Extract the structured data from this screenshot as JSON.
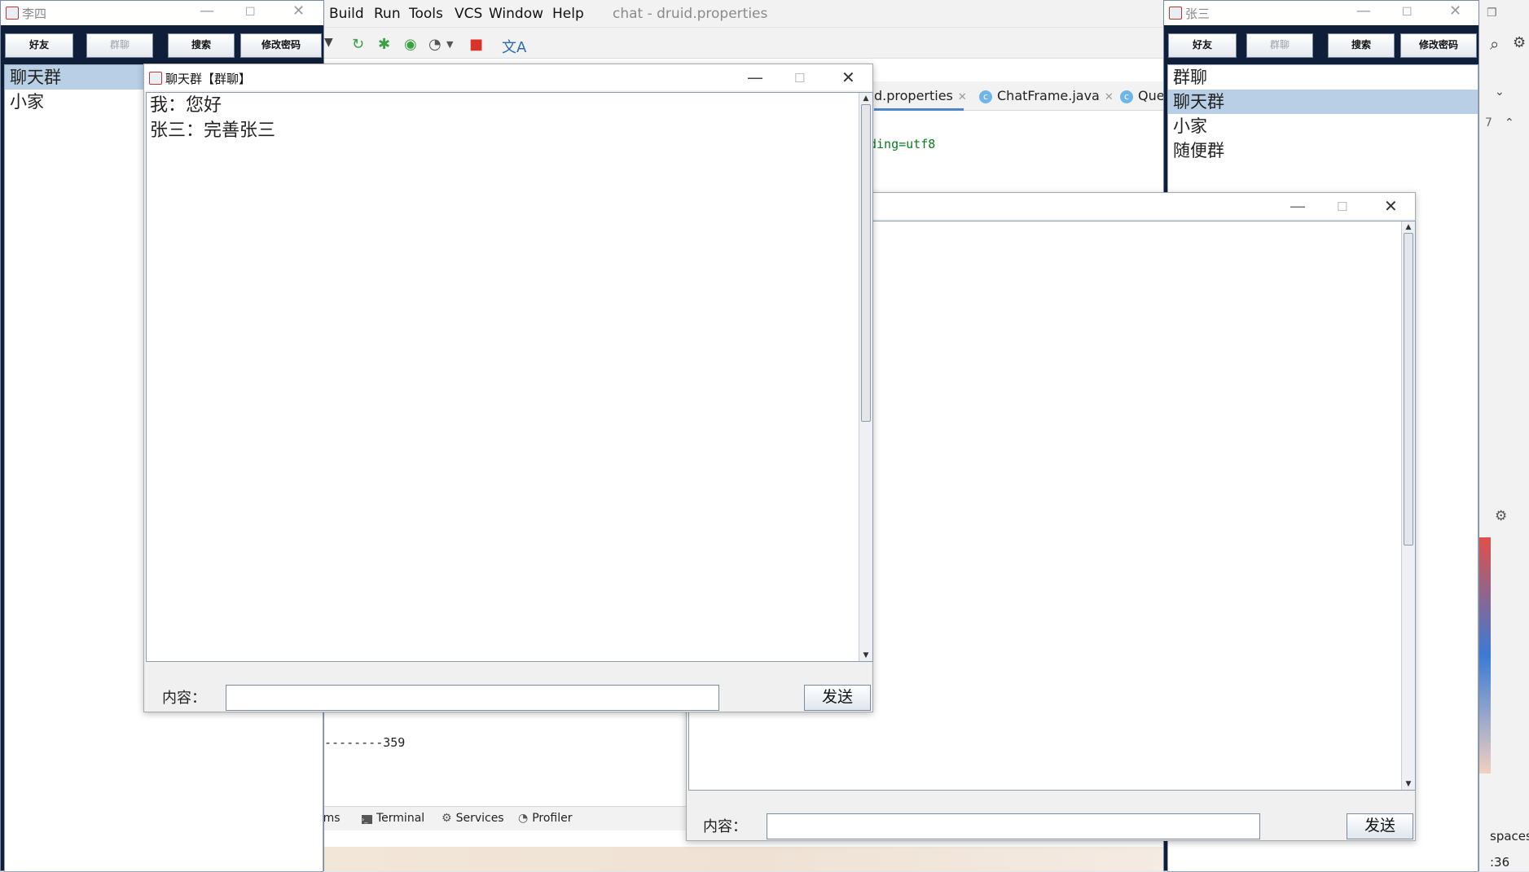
{
  "ide": {
    "menu": [
      "Build",
      "Run",
      "Tools",
      "VCS",
      "Window",
      "Help"
    ],
    "title": "chat - druid.properties",
    "tabs": [
      {
        "label": "d.properties",
        "closable": true
      },
      {
        "label": "ChatFrame.java",
        "closable": true
      },
      {
        "label": "Que",
        "closable": false
      }
    ],
    "code_line": "ding=utf8",
    "console_line": "--------359",
    "bottom_tools": [
      "ems",
      "Terminal",
      "Services",
      "Profiler"
    ],
    "right_fragments": {
      "line_no": "7",
      "spaces": "spaces",
      "time": ":36"
    }
  },
  "client_lisi": {
    "title": "李四",
    "buttons": [
      "好友",
      "群聊",
      "搜索",
      "修改密码"
    ],
    "list": [
      "聊天群",
      "小家"
    ],
    "selected_index": 0
  },
  "client_zhangsan": {
    "title": "张三",
    "buttons": [
      "好友",
      "群聊",
      "搜索",
      "修改密码"
    ],
    "list": [
      "群聊",
      "聊天群",
      "小家",
      "随便群"
    ],
    "selected_index": 1
  },
  "chat_dialog": {
    "title": "聊天群【群聊】",
    "messages": [
      "我：您好",
      "张三：完善张三"
    ],
    "content_label": "内容：",
    "input_value": "",
    "send_label": "发送"
  },
  "chat_dialog_2": {
    "title": "",
    "messages": [],
    "content_label": "内容：",
    "input_value": "",
    "send_label": "发送"
  }
}
